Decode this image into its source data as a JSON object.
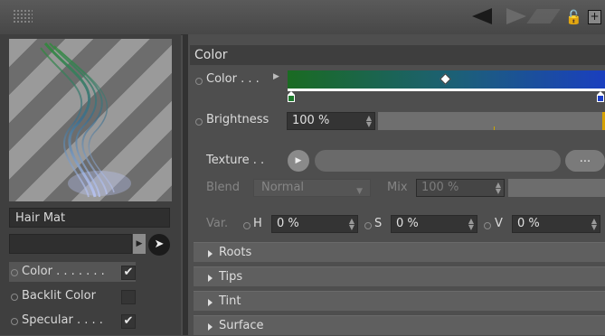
{
  "toolbar": {
    "grip_icon": "grip-dots-icon",
    "back_icon": "arrow-left-icon",
    "forward_icon": "arrow-right-icon",
    "up_icon": "arrow-up-icon",
    "lock_icon": "lock-icon",
    "newwin_icon": "new-window-icon"
  },
  "material": {
    "name": "Hair Mat"
  },
  "channels": [
    {
      "label": "Color . . . . . . .",
      "checked": true
    },
    {
      "label": "Backlit Color",
      "checked": false
    },
    {
      "label": "Specular . . . .",
      "checked": true
    }
  ],
  "section": {
    "title": "Color"
  },
  "color": {
    "label": "Color . . .",
    "gradient": {
      "start": "#1a6b22",
      "end": "#1a3fbf"
    }
  },
  "brightness": {
    "label": "Brightness",
    "value": "100 %",
    "fraction": 1.0
  },
  "texture": {
    "label": "Texture . .",
    "more": "..."
  },
  "blend": {
    "label": "Blend",
    "mode": "Normal",
    "mix_label": "Mix",
    "mix_value": "100 %"
  },
  "variation": {
    "label": "Var.",
    "h_label": "H",
    "h_value": "0 %",
    "s_label": "S",
    "s_value": "0 %",
    "v_label": "V",
    "v_value": "0 %"
  },
  "groups": [
    {
      "label": "Roots"
    },
    {
      "label": "Tips"
    },
    {
      "label": "Tint"
    },
    {
      "label": "Surface"
    }
  ],
  "checkmark": "✔"
}
